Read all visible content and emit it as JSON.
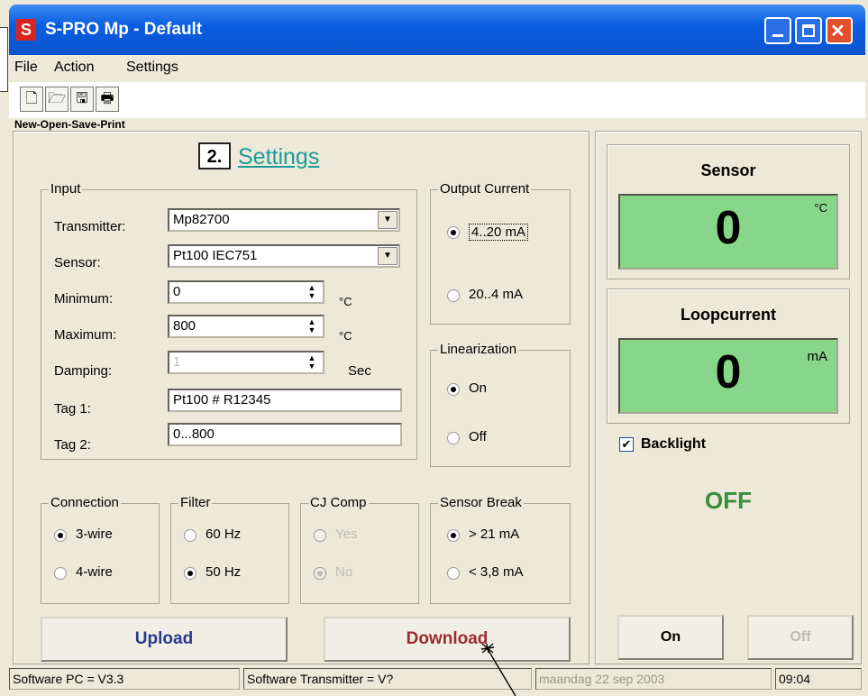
{
  "window": {
    "logo": "S",
    "title": "S-PRO Mp   - Default"
  },
  "menu": [
    "File",
    "Action",
    "Settings"
  ],
  "toolbar": {
    "buttons": [
      "new-icon",
      "open-folder-icon",
      "save-disk-icon",
      "print-icon"
    ],
    "caption": "New-Open-Save-Print"
  },
  "heading": {
    "number": "2.",
    "title": "Settings"
  },
  "input": {
    "legend": "Input",
    "transmitter_label": "Transmitter:",
    "transmitter_value": "Mp82700",
    "sensor_label": "Sensor:",
    "sensor_value": "Pt100 IEC751",
    "minimum_label": "Minimum:",
    "minimum_value": "0",
    "minimum_unit": "°C",
    "maximum_label": "Maximum:",
    "maximum_value": "800",
    "maximum_unit": "°C",
    "damping_label": "Damping:",
    "damping_value": "1",
    "damping_unit": "Sec",
    "tag1_label": "Tag 1:",
    "tag1_value": "Pt100 # R12345",
    "tag2_label": "Tag 2:",
    "tag2_value": "0...800"
  },
  "output_current": {
    "legend": "Output Current",
    "options": [
      "4..20 mA",
      "20..4 mA"
    ],
    "selected": "4..20 mA"
  },
  "linearization": {
    "legend": "Linearization",
    "options": [
      "On",
      "Off"
    ],
    "selected": "On"
  },
  "connection": {
    "legend": "Connection",
    "options": [
      "3-wire",
      "4-wire"
    ],
    "selected": "3-wire"
  },
  "filter": {
    "legend": "Filter",
    "options": [
      "60 Hz",
      "50 Hz"
    ],
    "selected": "50 Hz"
  },
  "cj_comp": {
    "legend": "CJ Comp",
    "options": [
      "Yes",
      "No"
    ],
    "selected": "No"
  },
  "sensor_break": {
    "legend": "Sensor Break",
    "options": [
      "> 21  mA",
      "< 3,8 mA"
    ],
    "selected": "> 21  mA"
  },
  "buttons": {
    "upload": "Upload",
    "download": "Download"
  },
  "right_panel": {
    "sensor_title": "Sensor",
    "sensor_value": "0",
    "sensor_unit": "°C",
    "loop_title": "Loopcurrent",
    "loop_value": "0",
    "loop_unit": "mA",
    "backlight_label": "Backlight",
    "backlight_checked": true,
    "backlight_state": "OFF",
    "on_button": "On",
    "off_button": "Off"
  },
  "status": {
    "software_pc": "Software PC  = V3.3",
    "software_transmitter": "Software Transmitter = V?",
    "date": "maandag 22 sep 2003",
    "time": "09:04"
  },
  "colors": {
    "titlebar": "#0b53cf",
    "display_green": "#88d68a",
    "settings_link": "#1f9b9b",
    "upload_text": "#283a8c",
    "download_text": "#9a2a32",
    "off_state": "#3a8d3a"
  }
}
